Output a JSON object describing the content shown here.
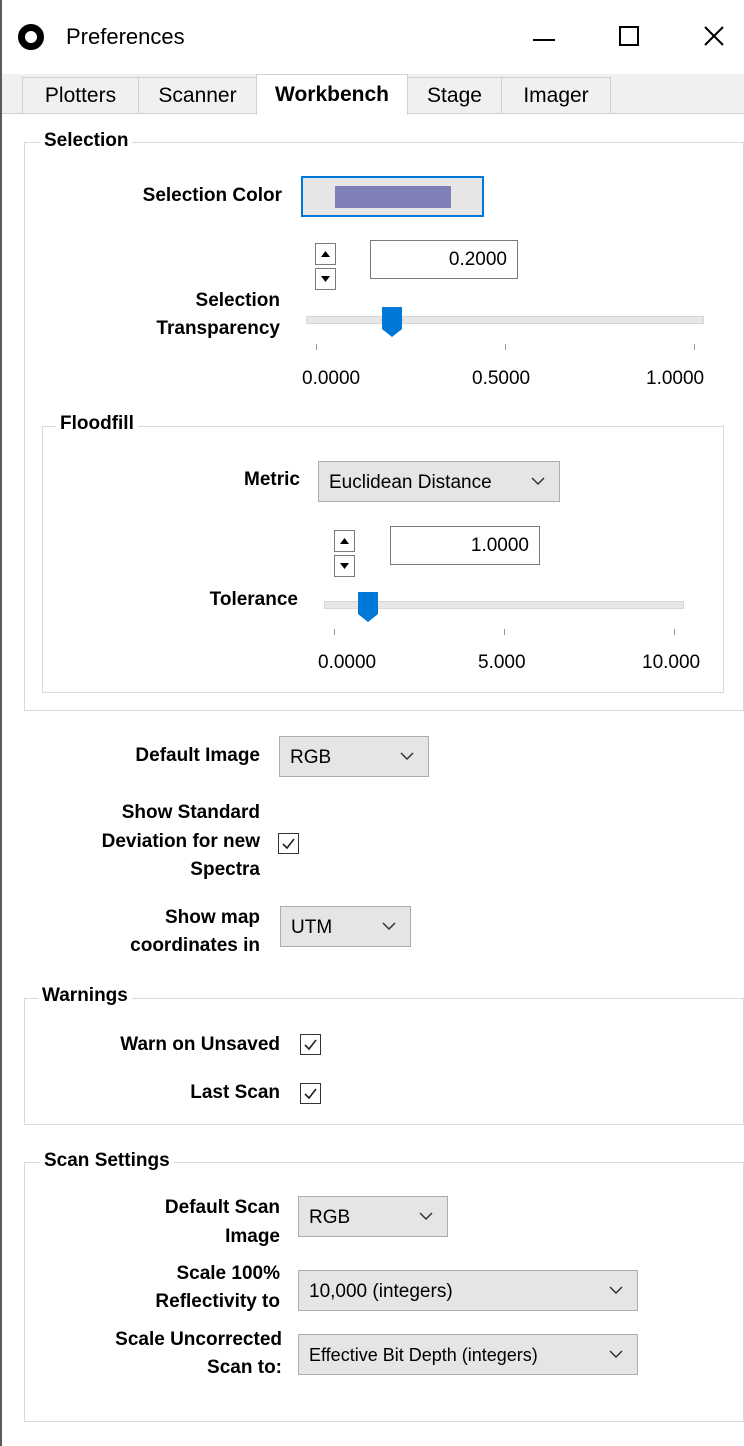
{
  "window": {
    "title": "Preferences"
  },
  "tabs": [
    {
      "label": "Plotters"
    },
    {
      "label": "Scanner"
    },
    {
      "label": "Workbench",
      "active": true
    },
    {
      "label": "Stage"
    },
    {
      "label": "Imager"
    }
  ],
  "selection": {
    "group_title": "Selection",
    "color_label": "Selection Color",
    "color_value": "#8080b8",
    "transparency_label_1": "Selection",
    "transparency_label_2": "Transparency",
    "transparency_value": "0.2000",
    "slider_min": "0.0000",
    "slider_mid": "0.5000",
    "slider_max": "1.0000",
    "slider_fraction": 0.2
  },
  "floodfill": {
    "group_title": "Floodfill",
    "metric_label": "Metric",
    "metric_value": "Euclidean Distance",
    "tolerance_label": "Tolerance",
    "tolerance_value": "1.0000",
    "slider_min": "0.0000",
    "slider_mid": "5.000",
    "slider_max": "10.000",
    "slider_fraction": 0.1
  },
  "general": {
    "default_image_label": "Default Image",
    "default_image_value": "RGB",
    "std_dev_label_1": "Show Standard",
    "std_dev_label_2": "Deviation for new",
    "std_dev_label_3": "Spectra",
    "std_dev_checked": true,
    "map_coords_label_1": "Show map",
    "map_coords_label_2": "coordinates in",
    "map_coords_value": "UTM"
  },
  "warnings": {
    "group_title": "Warnings",
    "unsaved_label": "Warn on Unsaved",
    "unsaved_checked": true,
    "last_scan_label": "Last Scan",
    "last_scan_checked": true
  },
  "scan_settings": {
    "group_title": "Scan Settings",
    "default_scan_label_1": "Default Scan",
    "default_scan_label_2": "Image",
    "default_scan_value": "RGB",
    "scale_refl_label_1": "Scale 100%",
    "scale_refl_label_2": "Reflectivity to",
    "scale_refl_value": "10,000 (integers)",
    "scale_uncorr_label_1": "Scale Uncorrected",
    "scale_uncorr_label_2": "Scan to:",
    "scale_uncorr_value": "Effective Bit Depth (integers)"
  },
  "icons": {
    "app": "circle-logo-icon",
    "minimize": "minimize-icon",
    "maximize": "maximize-icon",
    "close": "close-icon",
    "chevron": "chevron-down-icon",
    "check": "check-icon",
    "spin_up": "arrow-up-icon",
    "spin_down": "arrow-down-icon"
  },
  "colors": {
    "accent": "#0078d7",
    "selection_color": "#8080b8"
  }
}
